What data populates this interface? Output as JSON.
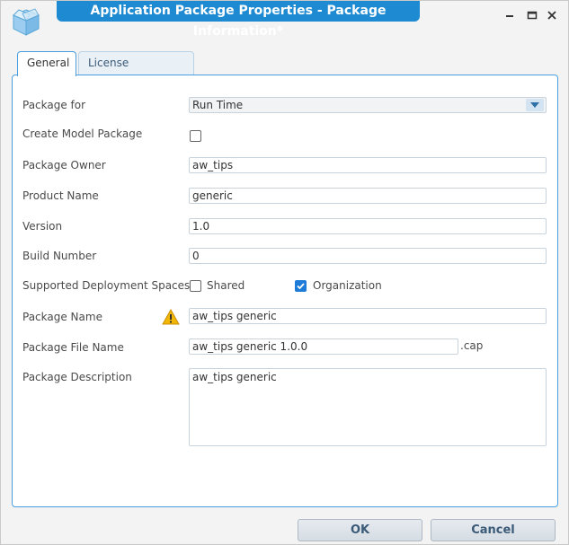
{
  "window": {
    "title": "Application Package Properties - Package Information*",
    "controls": [
      "minimize-icon",
      "maximize-icon",
      "close-icon"
    ]
  },
  "tabs": [
    {
      "label": "General",
      "active": true
    },
    {
      "label": "License Agreements",
      "active": false
    }
  ],
  "form": {
    "package_for": {
      "label": "Package for",
      "value": "Run Time"
    },
    "create_model": {
      "label": "Create Model Package",
      "checked": false
    },
    "package_owner": {
      "label": "Package Owner",
      "value": "aw_tips"
    },
    "product_name": {
      "label": "Product Name",
      "value": "generic"
    },
    "version": {
      "label": "Version",
      "value": "1.0"
    },
    "build_number": {
      "label": "Build Number",
      "value": "0"
    },
    "deployment": {
      "label": "Supported Deployment Spaces",
      "shared": {
        "label": "Shared",
        "checked": false
      },
      "organization": {
        "label": "Organization",
        "checked": true
      }
    },
    "package_name": {
      "label": "Package Name",
      "value": "aw_tips generic",
      "warning_icon": "warning-icon"
    },
    "package_file_name": {
      "label": "Package File Name",
      "value": "aw_tips generic 1.0.0",
      "suffix": ".cap"
    },
    "package_description": {
      "label": "Package Description",
      "value": "aw_tips generic"
    }
  },
  "buttons": {
    "ok": "OK",
    "cancel": "Cancel"
  },
  "colors": {
    "accent": "#1e8ad2",
    "checkbox_checked": "#1e7cd8",
    "warning": "#f2b705"
  }
}
